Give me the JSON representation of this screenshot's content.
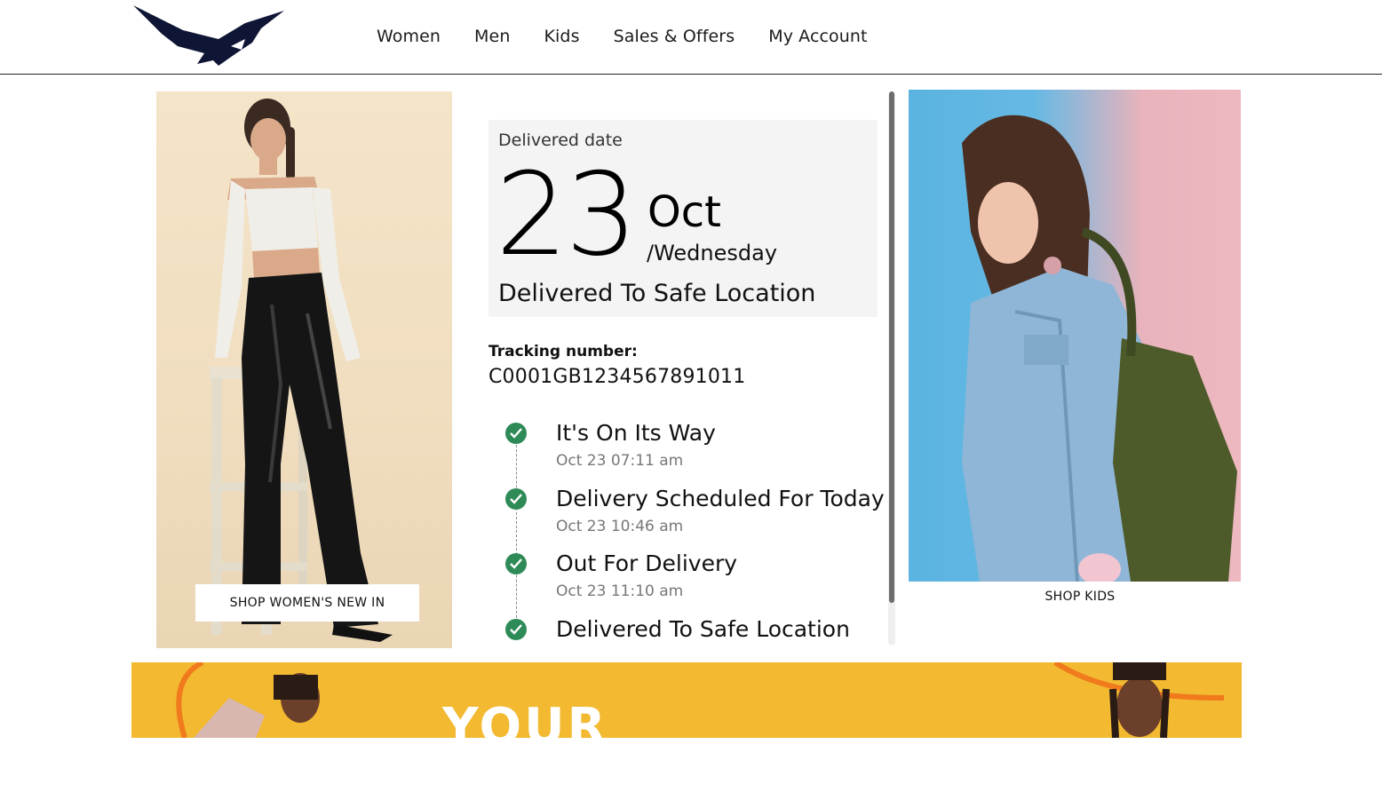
{
  "nav": {
    "items": [
      {
        "label": "Women"
      },
      {
        "label": "Men"
      },
      {
        "label": "Kids"
      },
      {
        "label": "Sales & Offers"
      },
      {
        "label": "My Account"
      }
    ]
  },
  "promo_left": {
    "button_label": "SHOP WOMEN'S NEW IN"
  },
  "delivery": {
    "label": "Delivered date",
    "day": "23",
    "month": "Oct",
    "weekday": "/Wednesday",
    "status": "Delivered To Safe Location"
  },
  "tracking": {
    "label": "Tracking number:",
    "number": "C0001GB1234567891011"
  },
  "timeline": [
    {
      "title": "It's On Its Way",
      "time": "Oct 23 07:11 am"
    },
    {
      "title": "Delivery Scheduled For Today",
      "time": "Oct 23 10:46 am"
    },
    {
      "title": "Out For Delivery",
      "time": "Oct 23 11:10 am"
    },
    {
      "title": "Delivered To Safe Location",
      "time": ""
    }
  ],
  "promo_right": {
    "label": "SHOP KIDS"
  },
  "banner": {
    "text": "YOUR"
  },
  "colors": {
    "check": "#2e8b57",
    "banner": "#f2b931",
    "logo": "#0f1535"
  }
}
